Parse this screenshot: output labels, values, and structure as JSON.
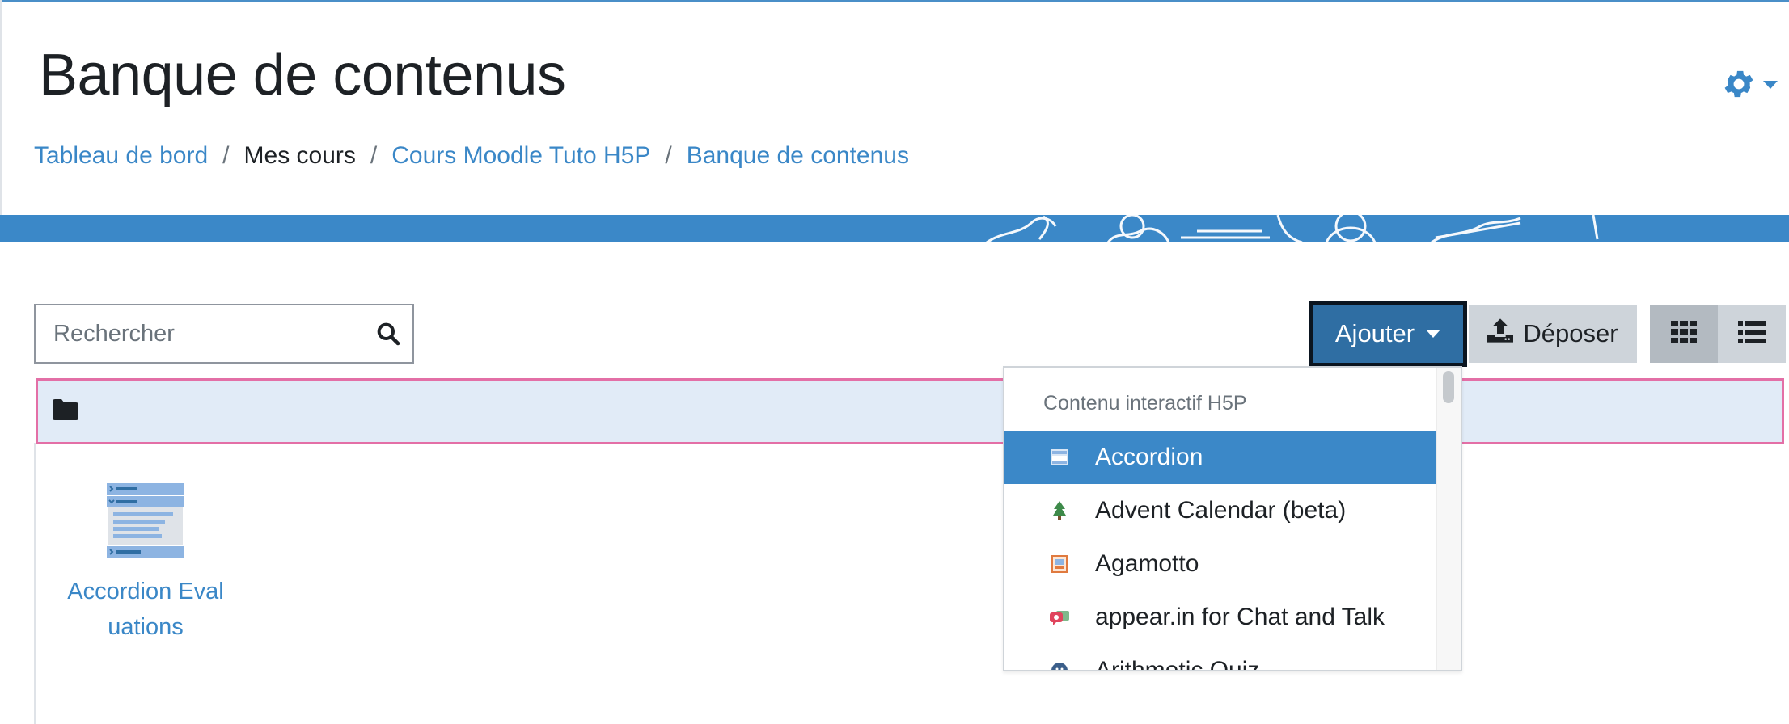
{
  "page": {
    "title": "Banque de contenus"
  },
  "breadcrumb": [
    {
      "label": "Tableau de bord",
      "link": true
    },
    {
      "label": "Mes cours",
      "link": false
    },
    {
      "label": "Cours Moodle Tuto H5P",
      "link": true
    },
    {
      "label": "Banque de contenus",
      "link": true
    }
  ],
  "toolbar": {
    "search_placeholder": "Rechercher",
    "add_label": "Ajouter",
    "upload_label": "Déposer",
    "grid_view_icon": "grid-icon",
    "list_view_icon": "list-icon"
  },
  "folder": {
    "icon": "folder-icon"
  },
  "items": [
    {
      "name": "Accordion Evaluations",
      "name_line1": "Accordion Eval",
      "name_line2": "uations",
      "icon": "accordion-icon"
    }
  ],
  "dropdown": {
    "header": "Contenu interactif H5P",
    "options": [
      {
        "label": "Accordion",
        "icon": "accordion-icon",
        "active": true
      },
      {
        "label": "Advent Calendar (beta)",
        "icon": "tree-icon",
        "active": false
      },
      {
        "label": "Agamotto",
        "icon": "agamotto-icon",
        "active": false
      },
      {
        "label": "appear.in for Chat and Talk",
        "icon": "chat-icon",
        "active": false
      },
      {
        "label": "Arithmetic Quiz",
        "icon": "quiz-icon",
        "active": false
      }
    ]
  },
  "colors": {
    "accent": "#3b88c8",
    "link": "#3a87c7",
    "add_button": "#2f6ea3",
    "folder_highlight": "#e36fa6"
  }
}
